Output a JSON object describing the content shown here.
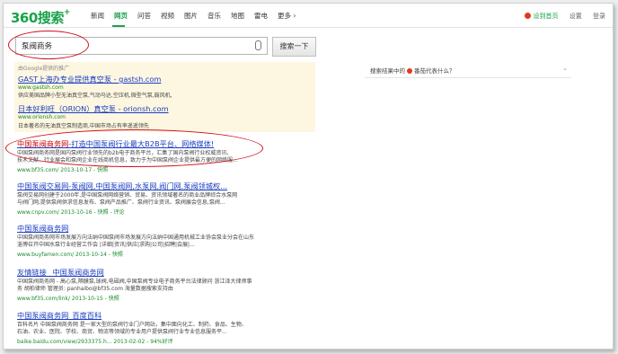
{
  "logo": {
    "num": "360",
    "cn": "搜索",
    "plus": "+"
  },
  "nav": [
    "新闻",
    "网页",
    "问答",
    "视频",
    "图片",
    "音乐",
    "地图",
    "雷电",
    "更多 ›"
  ],
  "nav_active_index": 1,
  "top_right": {
    "home": "设到首页",
    "settings": "设置",
    "login": "登录"
  },
  "search": {
    "query": "泵阀商务",
    "button": "搜索一下"
  },
  "ad": {
    "header": "由Google提供的推广",
    "items": [
      {
        "title": "GAST上海办专业提供真空泵 - gastsh.com",
        "url": "www.gastsh.com",
        "desc": "供应美国品牌小型无油真空泵,气动马达,空压机,微型气泵,鼓风机,"
      },
      {
        "title": "日本好利旺（ORION）真空泵 - orionsh.com",
        "url": "www.orionsh.com",
        "desc": "日本著名的无油真空泵制造商,中国市场占有率遥遥领先"
      }
    ]
  },
  "results": [
    {
      "title_a": "中国泵阀商务网",
      "title_b": "-打造中国泵阀行业最大B2B平台、网络媒体!",
      "d1": "中国泵阀商务网是国内泵阀行业领先的b2b电子商务平台，汇集了国内泵阀行业权威资讯、",
      "d2": "技术文献，行业展会和泵阀企业在线商机信息，致力于为中国泵阀企业提供最方便的网络服...",
      "url": "www.bf35.com/ 2013-10-17 - 快照"
    },
    {
      "title_a": "中国泵阀交易网-泵阀网,中国泵阀网,水泵网,阀门网,泵阀领城权",
      "title_b": "...",
      "d1": "泵阀交易网创建于2000年,是中国泵阀网络营销、贸易、资讯领域著名的商业品牌综合水泵网",
      "d2": "与阀门网,提供泵阀供求信息发布、泵阀产品推广、泵阀行业资讯、泵阀展会信息,泵阀...",
      "url": "www.cnpv.com/ 2013-10-16 - 快照 - 评论"
    },
    {
      "title_a": "中国泵阀商务网",
      "title_b": "",
      "d1": "中国泵阀商务网市场发展方向法纳中国泵阀市场发展方向法纳中国通用机械工业协会泵业分会在山东",
      "d2": "淄博召开中国水泵行业经营工作会 |详细|资讯|供应|求购|公司|招聘|会展|...",
      "url": "www.buyfamen.com/ 2013-10-14 - 快照"
    },
    {
      "title_a": "友情链接 _中国泵阀商务网",
      "title_b": "",
      "d1": "中国泵阀商务网 - 高心泵,隔膜泵,球阀,电磁阀,中国泵阀专业电子商务平台法律顾问 浙江泽大律师事",
      "d2": "务 胡柏律师 管理员: panhaibo@bf35.com 海量数据搜索支持由",
      "url": "www.bf35.com/link/ 2013-10-15 - 快照"
    },
    {
      "title_a": "中国泵阀商务网_百度百科",
      "title_b": "",
      "d1": "百科名片 中国泵阀商务网 是一家大型的泵阀行业门户网站，集中面向化工、制药、食品、生物、",
      "d2": "石油、农业、医院、学校、商贸、物流等领域的专业用户提供泵阀行业专业信息服务平...",
      "url": "baike.baidu.com/view/2933375.h... 2013-02-02 - 94%好评"
    }
  ],
  "sidebar": {
    "prefix": "搜索结果中的",
    "tag": "番茄代表什么？"
  }
}
